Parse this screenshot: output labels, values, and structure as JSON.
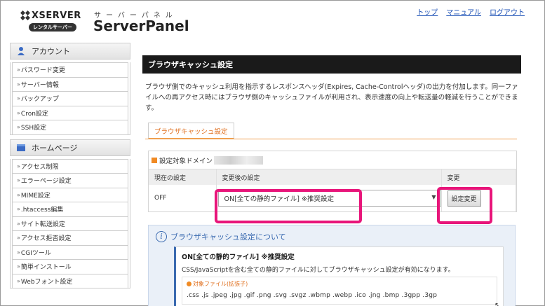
{
  "header": {
    "brand": "XSERVER",
    "rental_badge": "レンタルサーバー",
    "panel_kana": "サーバーパネル",
    "panel_title": "ServerPanel",
    "links": [
      "トップ",
      "マニュアル",
      "ログアウト"
    ]
  },
  "sidebar": {
    "account": {
      "heading": "アカウント",
      "items": [
        "パスワード変更",
        "サーバー情報",
        "バックアップ",
        "Cron設定",
        "SSH設定"
      ]
    },
    "homepage": {
      "heading": "ホームページ",
      "items": [
        "アクセス制限",
        "エラーページ設定",
        "MIME設定",
        ".htaccess編集",
        "サイト転送設定",
        "アクセス拒否設定",
        "CGIツール",
        "簡単インストール",
        "Webフォント設定"
      ]
    },
    "arrow": "»"
  },
  "main": {
    "title": "ブラウザキャッシュ設定",
    "description": "ブラウザ側でのキャッシュ利用を指示するレスポンスヘッダ(Expires, Cache-Controlヘッダ)の出力を付加します。同一ファイルへの再アクセス時にはブラウザ側のキャッシュファイルが利用され、表示速度の向上や転送量の軽減を行うことができます。",
    "tab": "ブラウザキャッシュ設定",
    "domain_label": "設定対象ドメイン",
    "table": {
      "headers": [
        "現在の設定",
        "変更後の設定",
        "変更"
      ],
      "current": "OFF",
      "selected_option": "ON[全ての静的ファイル] ※推奨設定",
      "change_button": "設定変更"
    },
    "info": {
      "heading": "ブラウザキャッシュ設定について",
      "box_title": "ON[全ての静的ファイル] ※推奨設定",
      "box_desc": "CSS/JavaScriptを含む全ての静的ファイルに対してブラウザキャッシュ設定が有効になります。",
      "target_label": "対象ファイル(拡張子)",
      "extensions": ".css .js .jpeg .jpg .gif .png .svg .svgz .wbmp .webp .ico .jng .bmp .3gpp .3gp"
    }
  },
  "colors": {
    "highlight": "#e8157a",
    "accent_orange": "#f08a24",
    "title_bar": "#1a1a1a",
    "link": "#1a4fb5"
  }
}
